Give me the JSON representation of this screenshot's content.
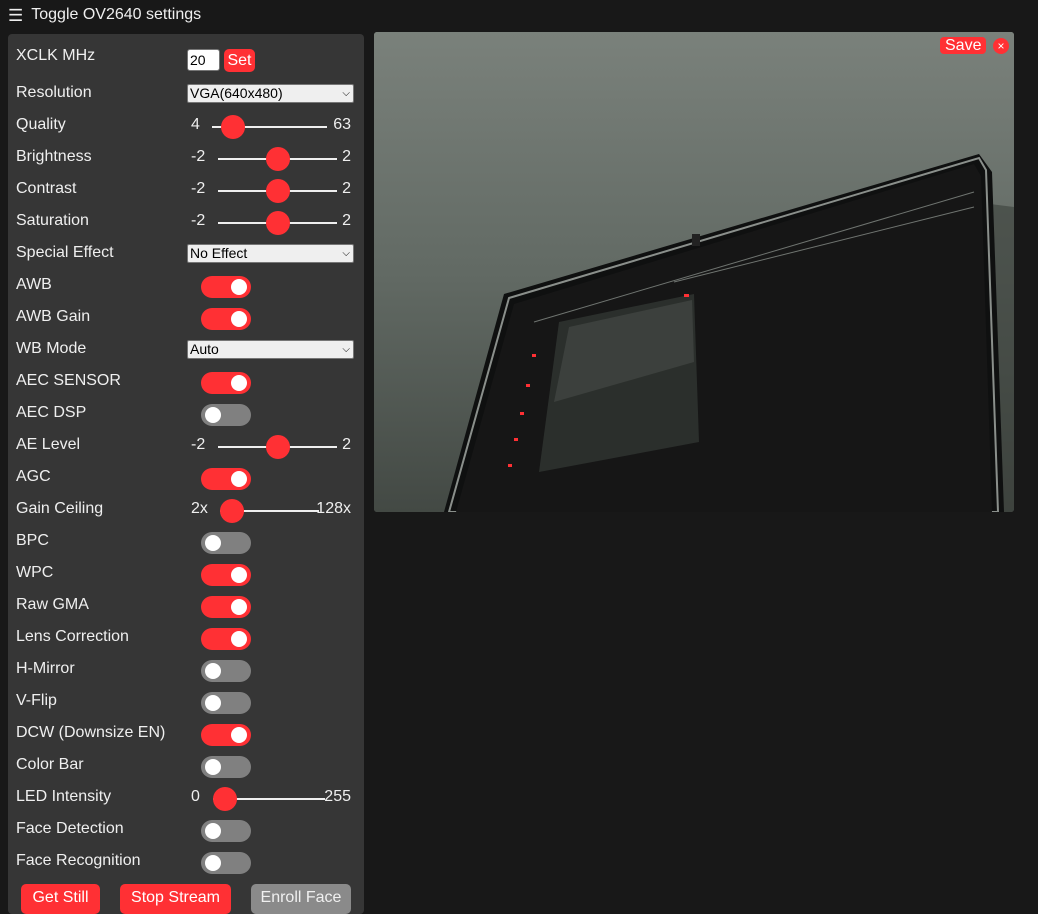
{
  "header": {
    "menu_icon": "☰",
    "title": "Toggle OV2640 settings"
  },
  "xclk": {
    "label": "XCLK MHz",
    "value": "20",
    "set_label": "Set"
  },
  "resolution": {
    "label": "Resolution",
    "selected": "VGA(640x480)"
  },
  "quality": {
    "label": "Quality",
    "min": "4",
    "max": "63",
    "value": 10
  },
  "brightness": {
    "label": "Brightness",
    "min": "-2",
    "max": "2",
    "value": 0
  },
  "contrast": {
    "label": "Contrast",
    "min": "-2",
    "max": "2",
    "value": 0
  },
  "saturation": {
    "label": "Saturation",
    "min": "-2",
    "max": "2",
    "value": 0
  },
  "special_effect": {
    "label": "Special Effect",
    "selected": "No Effect"
  },
  "awb": {
    "label": "AWB",
    "on": true
  },
  "awb_gain": {
    "label": "AWB Gain",
    "on": true
  },
  "wb_mode": {
    "label": "WB Mode",
    "selected": "Auto"
  },
  "aec_sensor": {
    "label": "AEC SENSOR",
    "on": true
  },
  "aec_dsp": {
    "label": "AEC DSP",
    "on": false
  },
  "ae_level": {
    "label": "AE Level",
    "min": "-2",
    "max": "2",
    "value": 0
  },
  "agc": {
    "label": "AGC",
    "on": true
  },
  "gain_ceiling": {
    "label": "Gain Ceiling",
    "min": "2x",
    "max": "128x",
    "value": 0
  },
  "bpc": {
    "label": "BPC",
    "on": false
  },
  "wpc": {
    "label": "WPC",
    "on": true
  },
  "raw_gma": {
    "label": "Raw GMA",
    "on": true
  },
  "lens_correction": {
    "label": "Lens Correction",
    "on": true
  },
  "h_mirror": {
    "label": "H-Mirror",
    "on": false
  },
  "v_flip": {
    "label": "V-Flip",
    "on": false
  },
  "dcw": {
    "label": "DCW (Downsize EN)",
    "on": true
  },
  "color_bar": {
    "label": "Color Bar",
    "on": false
  },
  "led_intensity": {
    "label": "LED Intensity",
    "min": "0",
    "max": "255",
    "value": 0
  },
  "face_detection": {
    "label": "Face Detection",
    "on": false
  },
  "face_recognition": {
    "label": "Face Recognition",
    "on": false
  },
  "buttons": {
    "get_still": "Get Still",
    "stop_stream": "Stop Stream",
    "enroll_face": "Enroll Face"
  },
  "viewer": {
    "save_label": "Save",
    "close_icon": "×"
  },
  "colors": {
    "accent": "#ff3034",
    "panel": "#363636",
    "background": "#181818",
    "toggle_off": "#808080"
  }
}
